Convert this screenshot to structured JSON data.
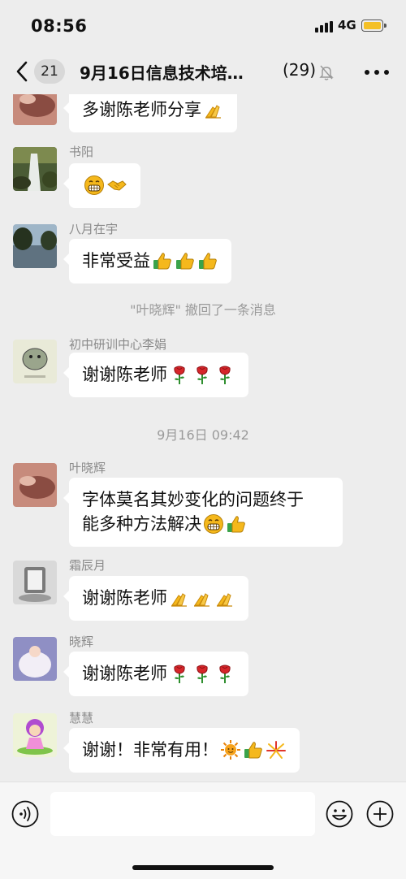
{
  "status_bar": {
    "time": "08:56",
    "network": "4G"
  },
  "nav": {
    "unread_count": "21",
    "title": "9月16日信息技术培…",
    "member_count": "(29)"
  },
  "messages": [
    {
      "sender": "",
      "text": "多谢陈老师分享",
      "emojis": [
        "folded-hands"
      ]
    },
    {
      "sender": "书阳",
      "text": "",
      "emojis": [
        "grin",
        "handshake"
      ]
    },
    {
      "sender": "八月在宇",
      "text": "非常受益",
      "emojis": [
        "thumbs-up",
        "thumbs-up",
        "thumbs-up"
      ]
    },
    {
      "system": "\"叶晓辉\" 撤回了一条消息"
    },
    {
      "sender": "初中研训中心李娟",
      "text": "谢谢陈老师",
      "emojis": [
        "rose",
        "rose",
        "rose"
      ]
    },
    {
      "system": "9月16日 09:42"
    },
    {
      "sender": "叶晓辉",
      "text_line1": "字体莫名其妙变化的问题终于",
      "text_line2": "能多种方法解决",
      "emojis": [
        "grin",
        "thumbs-up"
      ]
    },
    {
      "sender": "霜辰月",
      "text": "谢谢陈老师",
      "emojis": [
        "folded-hands",
        "folded-hands",
        "folded-hands"
      ]
    },
    {
      "sender": "晓辉",
      "text": "谢谢陈老师",
      "emojis": [
        "rose",
        "rose",
        "rose"
      ]
    },
    {
      "sender": "慧慧",
      "text": "谢谢！非常有用！",
      "emojis": [
        "sun",
        "thumbs-up",
        "firework"
      ]
    }
  ],
  "input_bar": {
    "placeholder": ""
  },
  "colors": {
    "background": "#ededed",
    "bubble": "#ffffff",
    "battery": "#f4c026",
    "emoji_yellow": "#f5b81c"
  }
}
